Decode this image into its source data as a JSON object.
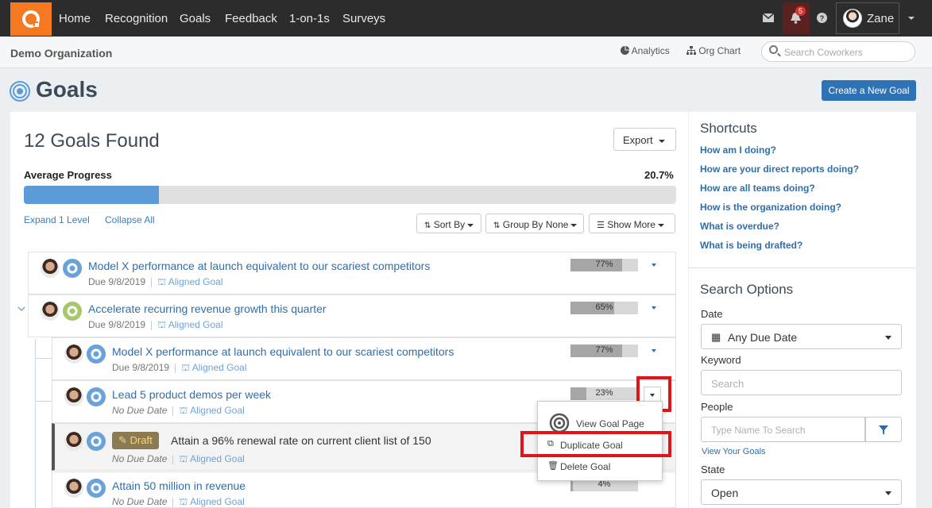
{
  "nav": {
    "items": [
      "Home",
      "Recognition",
      "Goals",
      "Feedback",
      "1-on-1s",
      "Surveys"
    ],
    "notification_count": "5",
    "user_name": "Zane",
    "icons": [
      "mail-icon",
      "bell-icon",
      "help-icon"
    ]
  },
  "subheader": {
    "org_name": "Demo Organization",
    "analytics": "Analytics",
    "org_chart": "Org Chart",
    "search_placeholder": "Search Coworkers"
  },
  "page": {
    "title": "Goals",
    "create_button": "Create a New Goal"
  },
  "main": {
    "found": "12 Goals Found",
    "export": "Export",
    "avg_label": "Average Progress",
    "avg_value": "20.7%",
    "avg_fraction": 0.207,
    "expand": "Expand 1 Level",
    "collapse": "Collapse All",
    "sort": "Sort By",
    "group": "Group By None",
    "show_more": "Show More"
  },
  "goals": [
    {
      "title": "Model X performance at launch equivalent to our scariest competitors",
      "due": "Due 9/8/2019",
      "aligned": "Aligned Goal",
      "progress": "77%",
      "fraction": 0.77
    },
    {
      "title": "Accelerate recurring revenue growth this quarter",
      "due": "Due 9/8/2019",
      "aligned": "Aligned Goal",
      "progress": "65%",
      "fraction": 0.65
    },
    {
      "title": "Model X performance at launch equivalent to our scariest competitors",
      "due": "Due 9/8/2019",
      "aligned": "Aligned Goal",
      "progress": "77%",
      "fraction": 0.77
    },
    {
      "title": "Lead 5 product demos per week",
      "due": "No Due Date",
      "aligned": "Aligned Goal",
      "progress": "23%",
      "fraction": 0.23
    },
    {
      "title": "Attain a 96% renewal rate on current client list of 150",
      "due": "No Due Date",
      "aligned": "Aligned Goal",
      "draft": "Draft"
    },
    {
      "title": "Attain 50 million in revenue",
      "due": "No Due Date",
      "aligned": "Aligned Goal",
      "progress": "4%",
      "fraction": 0.04
    }
  ],
  "menu": {
    "view": "View Goal Page",
    "duplicate": "Duplicate Goal",
    "delete": "Delete Goal"
  },
  "sidebar": {
    "shortcuts_title": "Shortcuts",
    "shortcuts": [
      "How am I doing?",
      "How are your direct reports doing?",
      "How are all teams doing?",
      "How is the organization doing?",
      "What is overdue?",
      "What is being drafted?"
    ],
    "search_title": "Search Options",
    "date_label": "Date",
    "date_value": "Any Due Date",
    "keyword_label": "Keyword",
    "keyword_placeholder": "Search",
    "people_label": "People",
    "people_placeholder": "Type Name To Search",
    "view_your_goals": "View Your Goals",
    "state_label": "State",
    "state_value": "Open"
  },
  "colors": {
    "accent": "#2f73b7",
    "brand": "#f47920",
    "highlight": "#e0141b",
    "progress_fill": "#5b9bd8"
  }
}
